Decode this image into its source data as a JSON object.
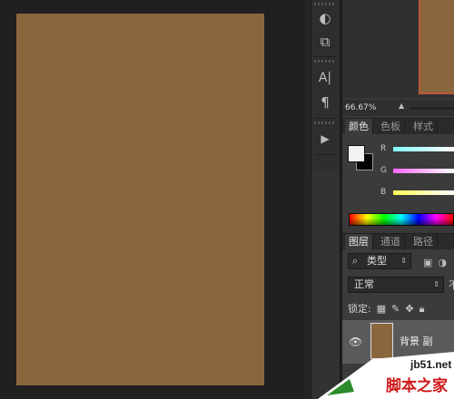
{
  "document": {
    "fill_color": "#8a663e"
  },
  "tool_strip": {
    "tools": [
      {
        "icon": "adjust-icon",
        "glyph": "◐"
      },
      {
        "icon": "3d-cube-icon",
        "glyph": "⧉"
      },
      {
        "icon": "character-icon",
        "glyph": "A|"
      },
      {
        "icon": "paragraph-icon",
        "glyph": "¶"
      },
      {
        "icon": "play-icon",
        "glyph": "▶"
      }
    ]
  },
  "navigator": {
    "zoom": "66.67%"
  },
  "color_panel": {
    "tabs": [
      "颜色",
      "色板",
      "样式"
    ],
    "active_tab": 0,
    "channels": [
      "R",
      "G",
      "B"
    ],
    "foreground": "#f2f2f2",
    "background": "#050505"
  },
  "layers_panel": {
    "tabs": [
      "图层",
      "通道",
      "路径"
    ],
    "active_tab": 0,
    "filter_label": "类型",
    "search_glyph": "⌕",
    "blend_mode": "正常",
    "opacity_label_partial": "不",
    "lock_label": "锁定:",
    "layer": {
      "name": "背景 副",
      "visible": true
    }
  },
  "watermark": {
    "url": "jb51.net",
    "text": "脚本之家"
  }
}
